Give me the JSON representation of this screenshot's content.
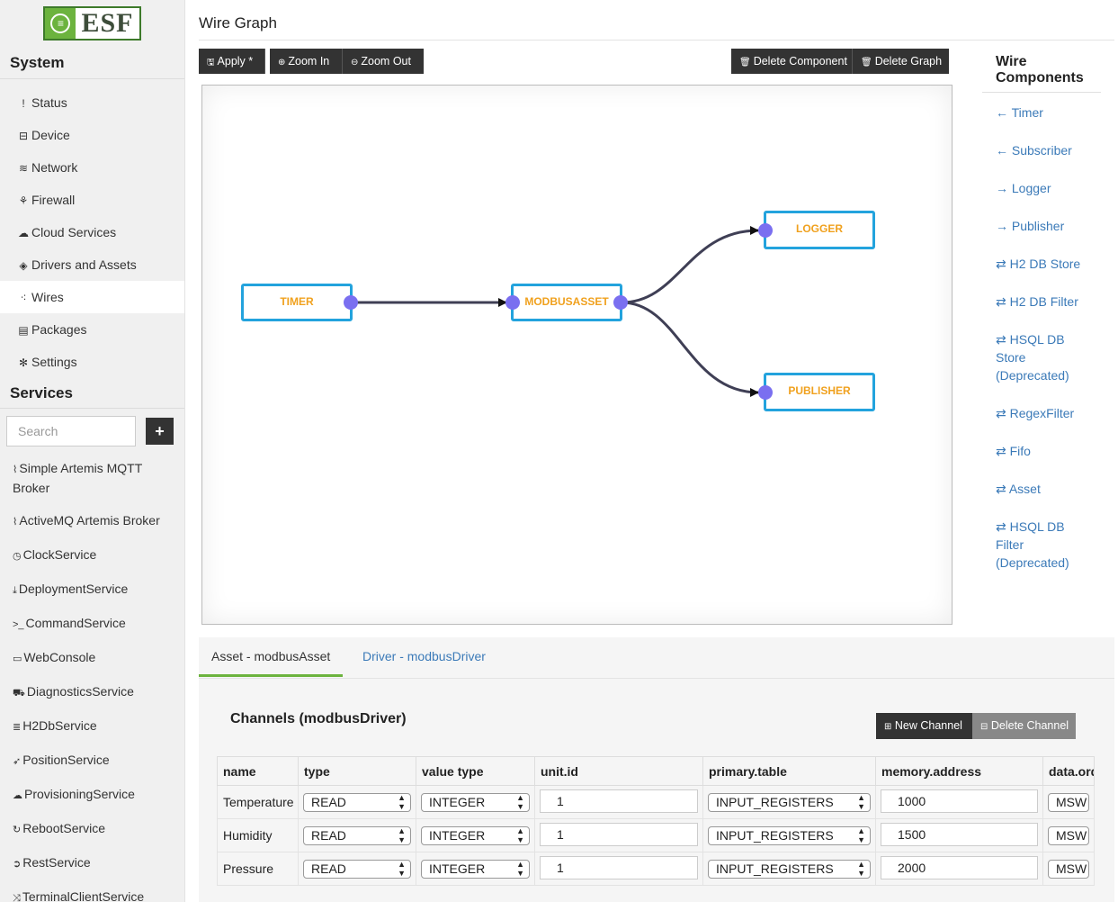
{
  "brand": {
    "logo_text": "ESF"
  },
  "sidebar": {
    "system_heading": "System",
    "system_items": [
      {
        "icon": "exclamation-icon",
        "glyph": "!",
        "label": "Status"
      },
      {
        "icon": "device-icon",
        "glyph": "⊟",
        "label": "Device"
      },
      {
        "icon": "wifi-icon",
        "glyph": "≋",
        "label": "Network"
      },
      {
        "icon": "fire-icon",
        "glyph": "⚘",
        "label": "Firewall"
      },
      {
        "icon": "cloud-icon",
        "glyph": "☁",
        "label": "Cloud Services"
      },
      {
        "icon": "cube-icon",
        "glyph": "◈",
        "label": "Drivers and Assets"
      },
      {
        "icon": "wires-icon",
        "glyph": "⁖",
        "label": "Wires"
      },
      {
        "icon": "packages-icon",
        "glyph": "▤",
        "label": "Packages"
      },
      {
        "icon": "gear-icon",
        "glyph": "✻",
        "label": "Settings"
      }
    ],
    "services_heading": "Services",
    "search_placeholder": "Search",
    "add_label": "+",
    "services": [
      {
        "icon": "rss-icon",
        "glyph": "⌇",
        "label": "Simple Artemis MQTT Broker"
      },
      {
        "icon": "rss-icon",
        "glyph": "⌇",
        "label": "ActiveMQ Artemis Broker"
      },
      {
        "icon": "clock-icon",
        "glyph": "◷",
        "label": "ClockService"
      },
      {
        "icon": "download-icon",
        "glyph": "⤓",
        "label": "DeploymentService"
      },
      {
        "icon": "terminal-icon",
        "glyph": ">_",
        "label": "CommandService"
      },
      {
        "icon": "laptop-icon",
        "glyph": "▭",
        "label": "WebConsole"
      },
      {
        "icon": "ambulance-icon",
        "glyph": "⛟",
        "label": "DiagnosticsService"
      },
      {
        "icon": "database-icon",
        "glyph": "≣",
        "label": "H2DbService"
      },
      {
        "icon": "location-arrow-icon",
        "glyph": "➶",
        "label": "PositionService"
      },
      {
        "icon": "cloud-upload-icon",
        "glyph": "☁",
        "label": "ProvisioningService"
      },
      {
        "icon": "refresh-icon",
        "glyph": "↻",
        "label": "RebootService"
      },
      {
        "icon": "chevron-circle-icon",
        "glyph": "➲",
        "label": "RestService"
      },
      {
        "icon": "random-icon",
        "glyph": "⤨",
        "label": "TerminalClientService"
      }
    ]
  },
  "page": {
    "title": "Wire Graph"
  },
  "toolbar": {
    "apply": "Apply *",
    "zoom_in": "Zoom In",
    "zoom_out": "Zoom Out",
    "delete_component": "Delete Component",
    "delete_graph": "Delete Graph"
  },
  "graph": {
    "nodes": [
      "TIMER",
      "MODBUSASSET",
      "LOGGER",
      "PUBLISHER"
    ]
  },
  "wire_components": {
    "title": "Wire Components",
    "items": [
      "← Timer",
      "← Subscriber",
      "→ Logger",
      "→ Publisher",
      "⇄ H2 DB Store",
      "⇄ H2 DB Filter",
      "⇄ HSQL DB Store (Deprecated)",
      "⇄ RegexFilter",
      "⇄ Fifo",
      "⇄ Asset",
      "⇄ HSQL DB Filter (Deprecated)"
    ]
  },
  "tabs": {
    "asset": "Asset - modbusAsset",
    "driver": "Driver - modbusDriver"
  },
  "channels": {
    "title": "Channels (modbusDriver)",
    "new_channel": "New Channel",
    "delete_channel": "Delete Channel",
    "columns": [
      "name",
      "type",
      "value type",
      "unit.id",
      "primary.table",
      "memory.address",
      "data.order"
    ],
    "rows": [
      {
        "name": "Temperature",
        "type": "READ",
        "value_type": "INTEGER",
        "unit_id": "1",
        "primary_table": "INPUT_REGISTERS",
        "memory_address": "1000",
        "data_order": "MSW"
      },
      {
        "name": "Humidity",
        "type": "READ",
        "value_type": "INTEGER",
        "unit_id": "1",
        "primary_table": "INPUT_REGISTERS",
        "memory_address": "1500",
        "data_order": "MSW"
      },
      {
        "name": "Pressure",
        "type": "READ",
        "value_type": "INTEGER",
        "unit_id": "1",
        "primary_table": "INPUT_REGISTERS",
        "memory_address": "2000",
        "data_order": "MSW"
      }
    ]
  },
  "colors": {
    "node_border": "#23a3dd",
    "node_text": "#f0a11e",
    "port": "#7a6ff0",
    "wire": "#3f3f55",
    "link": "#3b7ab8",
    "active_tab": "#6cb33e"
  }
}
